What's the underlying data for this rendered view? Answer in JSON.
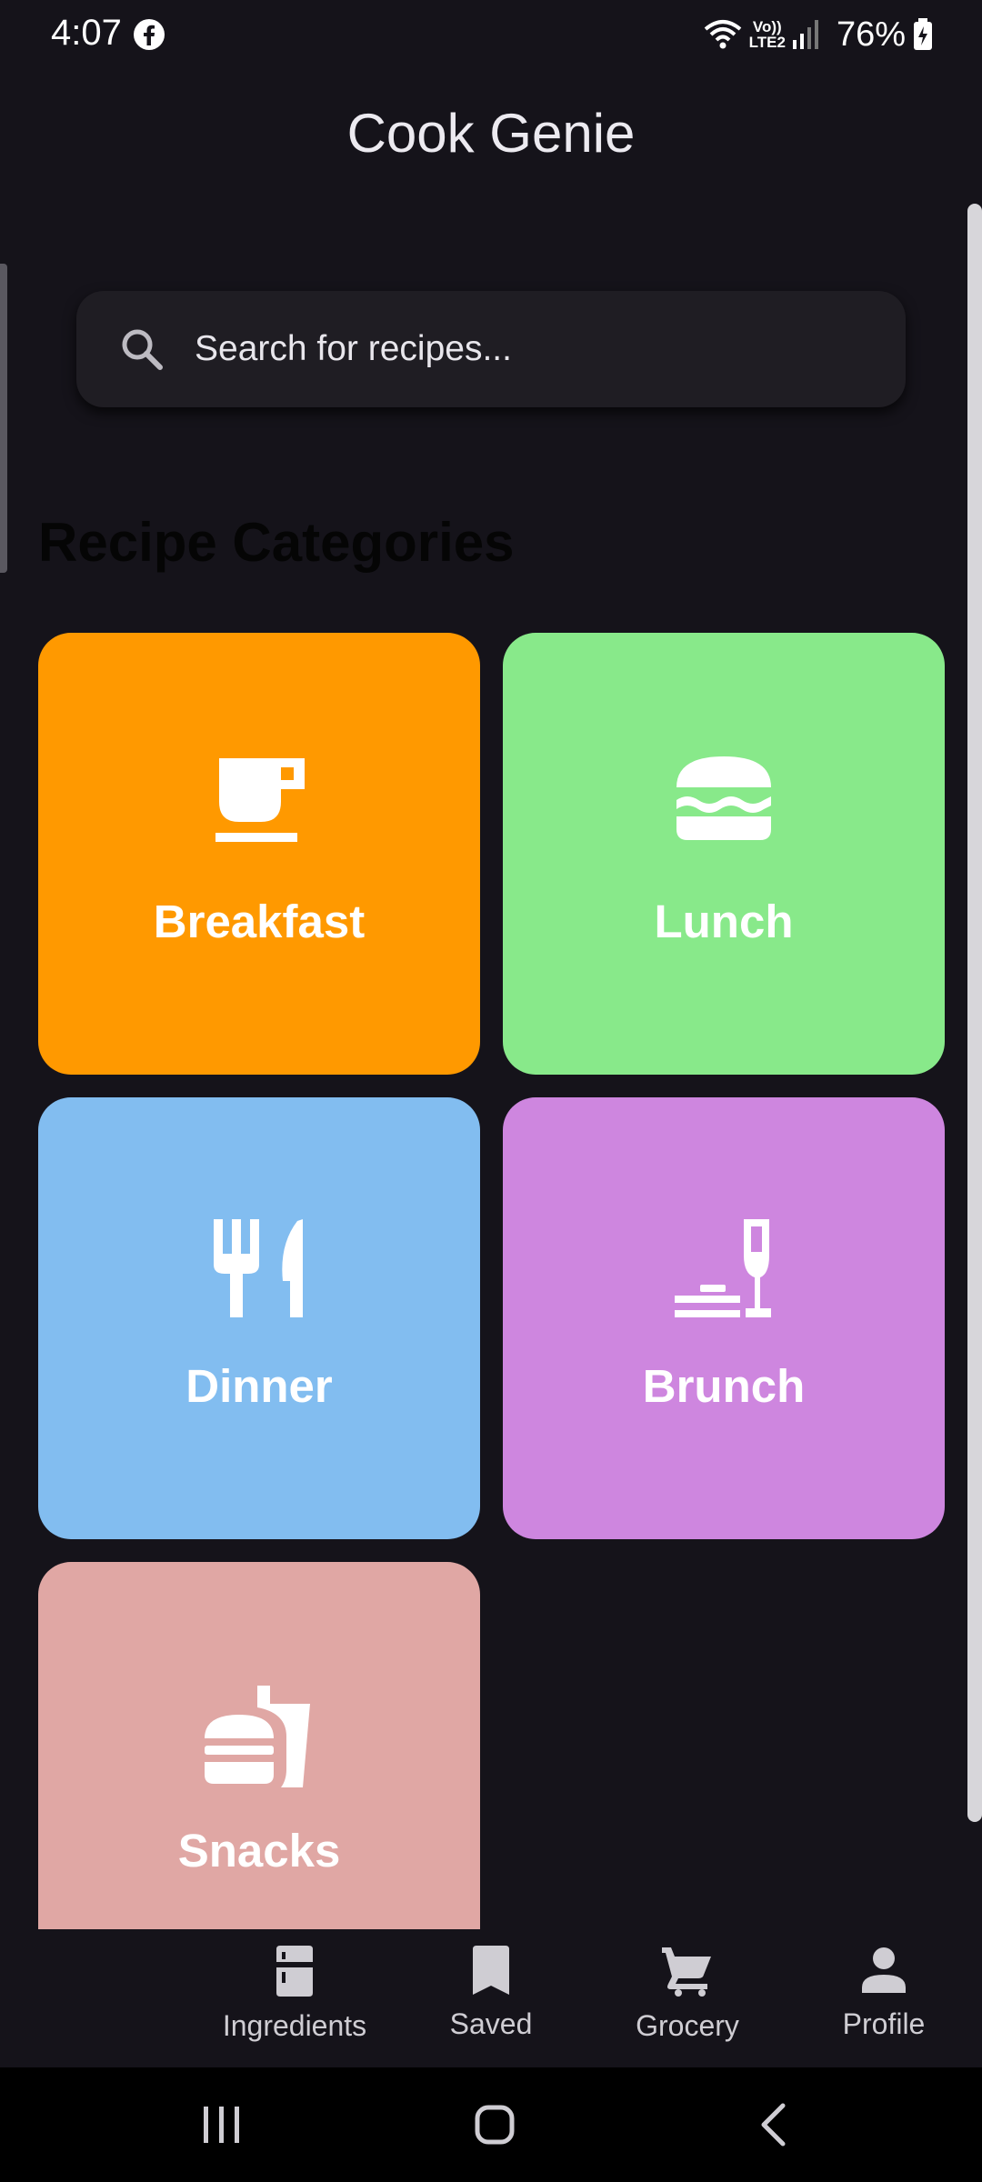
{
  "status_bar": {
    "time": "4:07",
    "network_label_top": "Vo))",
    "network_label_bottom": "LTE2",
    "battery": "76%",
    "icons": [
      "facebook-icon",
      "wifi-icon",
      "signal-icon",
      "battery-icon"
    ]
  },
  "header": {
    "title": "Cook Genie"
  },
  "search": {
    "placeholder": "Search for recipes...",
    "value": ""
  },
  "section": {
    "title": "Recipe Categories"
  },
  "categories": [
    {
      "label": "Breakfast",
      "icon": "coffee-cup-icon",
      "color": "#ff9900"
    },
    {
      "label": "Lunch",
      "icon": "burger-icon",
      "color": "#88e98a"
    },
    {
      "label": "Dinner",
      "icon": "fork-knife-icon",
      "color": "#82bdf0"
    },
    {
      "label": "Brunch",
      "icon": "brunch-dining-icon",
      "color": "#ce86df"
    },
    {
      "label": "Snacks",
      "icon": "fastfood-icon",
      "color": "#e0a7a4"
    }
  ],
  "bottom_nav": {
    "items": [
      {
        "label": "Ingredients",
        "icon": "fridge-icon"
      },
      {
        "label": "Saved",
        "icon": "bookmark-icon"
      },
      {
        "label": "Grocery",
        "icon": "cart-icon"
      },
      {
        "label": "Profile",
        "icon": "person-icon"
      }
    ]
  },
  "system_nav": {
    "icons": [
      "recents-icon",
      "home-icon",
      "back-icon"
    ]
  }
}
